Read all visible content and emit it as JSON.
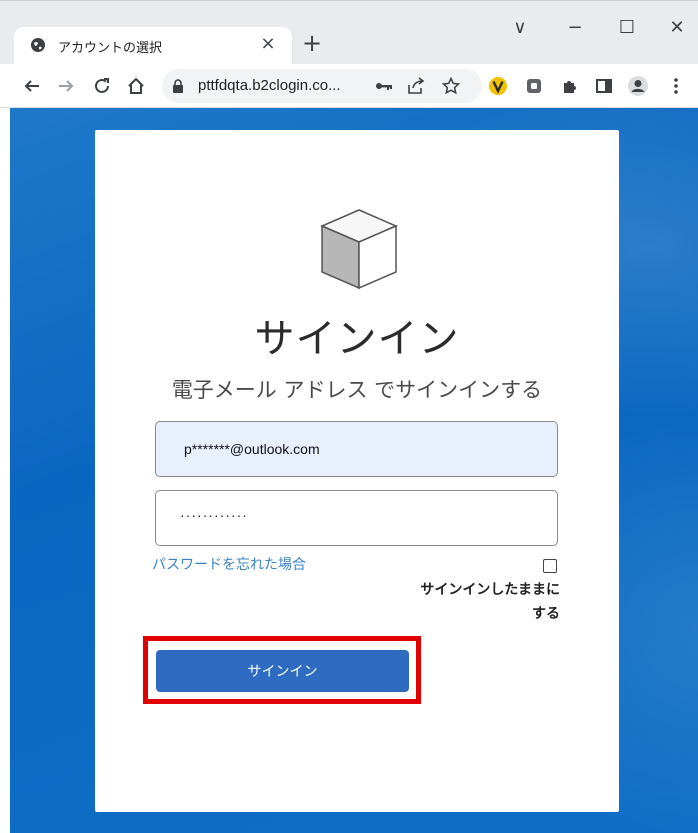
{
  "browser": {
    "tab_title": "アカウントの選択",
    "tab_close": "×",
    "new_tab": "+",
    "url": "pttfdqta.b2clogin.co...",
    "window_controls": {
      "dropdown": "∨",
      "minimize": "−",
      "maximize": "☐",
      "close": "✕"
    },
    "icons": [
      "globe-icon",
      "back-icon",
      "forward-icon",
      "reload-icon",
      "home-icon",
      "lock-icon",
      "key-icon",
      "share-icon",
      "star-icon",
      "v-extension-icon",
      "extension-icon",
      "puzzle-icon",
      "sidepanel-icon",
      "profile-icon",
      "kebab-menu-icon"
    ]
  },
  "page": {
    "background_color": "#0a67c1",
    "title": "サインイン",
    "subtitle": "電子メール アドレス でサインインする",
    "email_value": "p*******@outlook.com",
    "password_value": "············",
    "forgot_password": "パスワードを忘れた場合",
    "keep_signed_in_line1": "サインインしたままに",
    "keep_signed_in_line2": "する",
    "keep_signed_in_checked": false,
    "signin_button": "サインイン",
    "button_color": "#2f6cc1",
    "highlight_color": "#e30000"
  }
}
